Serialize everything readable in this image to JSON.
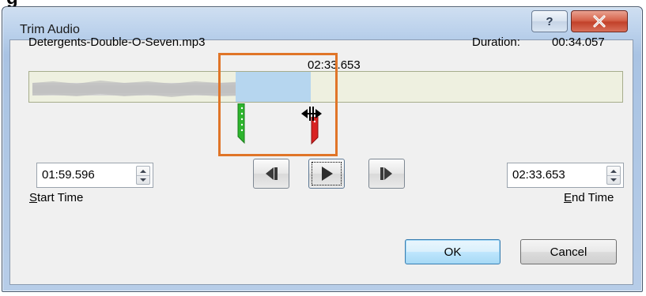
{
  "window": {
    "title": "Trim Audio",
    "help_label": "?",
    "close_icon": "close-icon"
  },
  "top_fragment_text": "g",
  "file": {
    "name": "Detergents-Double-O-Seven.mp3",
    "duration_label": "Duration:",
    "duration_value": "00:34.057"
  },
  "timeline": {
    "hover_time": "02:33.653",
    "start_handle_color": "#2db52d",
    "end_handle_color": "#d92323",
    "selection_color": "#b6d6ef",
    "highlight_color": "#e07528",
    "cursor_icon": "resize-horizontal-cursor-icon"
  },
  "start_time": {
    "value": "01:59.596",
    "label_prefix": "S",
    "label_rest": "tart Time"
  },
  "end_time": {
    "value": "02:33.653",
    "label_prefix": "E",
    "label_rest": "nd Time"
  },
  "playback": {
    "prev_icon": "previous-frame-icon",
    "play_icon": "play-icon",
    "next_icon": "next-frame-icon"
  },
  "buttons": {
    "ok": "OK",
    "cancel": "Cancel"
  }
}
